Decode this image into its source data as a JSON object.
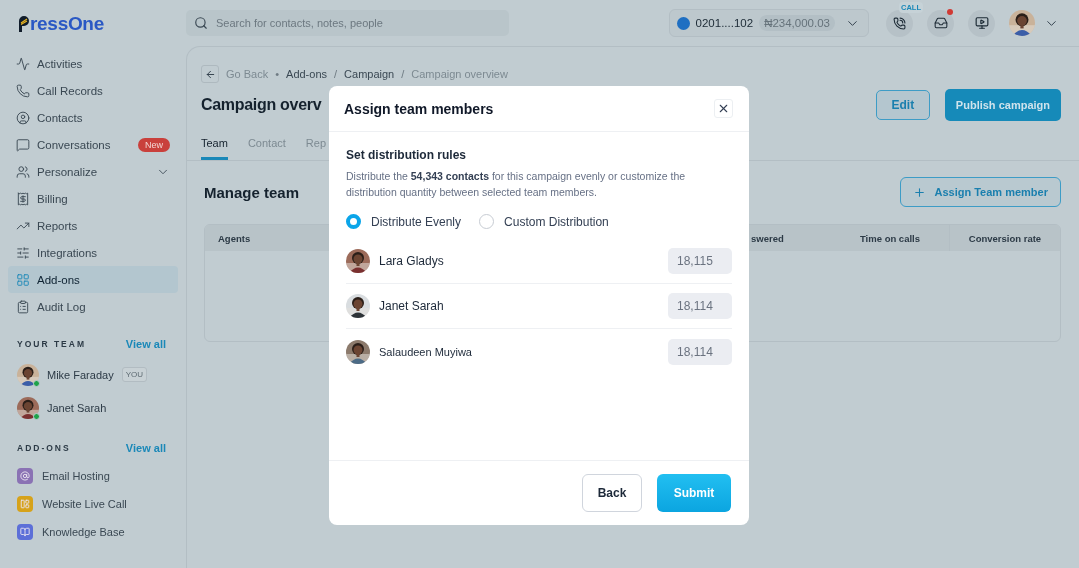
{
  "logo": {
    "text": "ressOne"
  },
  "search": {
    "placeholder": "Search for contacts, notes, people"
  },
  "account": {
    "number": "0201....102",
    "balance": "₦234,000.03"
  },
  "topbar": {
    "call_label": "CALL",
    "inbox_unread": true
  },
  "sidebar": {
    "items": [
      {
        "label": "Activities",
        "selected": false
      },
      {
        "label": "Call Records",
        "selected": false
      },
      {
        "label": "Contacts",
        "selected": false
      },
      {
        "label": "Conversations",
        "selected": false,
        "badge": "New"
      },
      {
        "label": "Personalize",
        "selected": false,
        "expandable": true
      },
      {
        "label": "Billing",
        "selected": false
      },
      {
        "label": "Reports",
        "selected": false
      },
      {
        "label": "Integrations",
        "selected": false
      },
      {
        "label": "Add-ons",
        "selected": true
      },
      {
        "label": "Audit Log",
        "selected": false
      }
    ]
  },
  "team": {
    "heading": "YOUR TEAM",
    "view_all": "View all",
    "members": [
      {
        "name": "Mike Faraday",
        "tag": "YOU",
        "online": true
      },
      {
        "name": "Janet Sarah",
        "online": true
      }
    ]
  },
  "addons": {
    "heading": "ADD-ONS",
    "view_all": "View all",
    "items": [
      {
        "label": "Email Hosting",
        "color": "#8a72b4"
      },
      {
        "label": "Website Live Call",
        "color": "#d6a21a"
      },
      {
        "label": "Knowledge Base",
        "color": "#5c6fd8"
      }
    ]
  },
  "breadcrumb": {
    "back": "Go Back",
    "bullet": "•",
    "slash": "/",
    "items": [
      "Add-ons",
      "Campaign",
      "Campaign overview"
    ]
  },
  "page": {
    "title": "Campaign overv",
    "edit": "Edit",
    "publish": "Publish campaign"
  },
  "tabs": [
    {
      "label": "Team",
      "selected": true
    },
    {
      "label": "Contact",
      "selected": false
    },
    {
      "label": "Rep",
      "selected": false
    }
  ],
  "section": {
    "title": "Manage team",
    "action": "Assign Team member"
  },
  "table": {
    "columns": [
      "Agents",
      "swered",
      "Time on calls",
      "Conversion rate"
    ]
  },
  "modal": {
    "title": "Assign team members",
    "subtitle": "Set distribution rules",
    "description": "Distribute the **54,343 contacts** for this campaign evenly or customize the distribution quantity between selected team members.",
    "options": [
      {
        "label": "Distribute Evenly",
        "selected": true
      },
      {
        "label": "Custom Distribution",
        "selected": false
      }
    ],
    "members": [
      {
        "name": "Lara Gladys",
        "value": "18,115"
      },
      {
        "name": "Janet Sarah",
        "value": "18,114"
      },
      {
        "name": "Salaudeen Muyiwa",
        "value": "18,114"
      }
    ],
    "back": "Back",
    "submit": "Submit"
  }
}
